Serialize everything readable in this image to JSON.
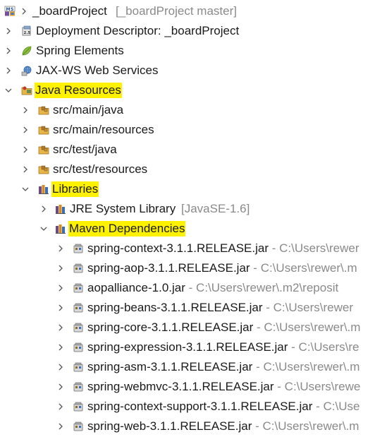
{
  "tree": {
    "project": {
      "name": "_boardProject",
      "decoration": "[_boardProject master]",
      "icon": "maven-web-project-icon"
    },
    "items": [
      {
        "label": "Deployment Descriptor: _boardProject",
        "icon": "deployment-descriptor-icon"
      },
      {
        "label": "Spring Elements",
        "icon": "spring-leaf-icon"
      },
      {
        "label": "JAX-WS Web Services",
        "icon": "web-services-icon"
      },
      {
        "label": "Java Resources",
        "icon": "java-resources-icon"
      },
      {
        "label": "src/main/java",
        "icon": "package-folder-icon"
      },
      {
        "label": "src/main/resources",
        "icon": "package-folder-icon"
      },
      {
        "label": "src/test/java",
        "icon": "package-folder-icon"
      },
      {
        "label": "src/test/resources",
        "icon": "package-folder-icon"
      },
      {
        "label": "Libraries",
        "icon": "libraries-icon"
      },
      {
        "label": "JRE System Library",
        "decoration": "[JavaSE-1.6]",
        "icon": "library-icon"
      },
      {
        "label": "Maven Dependencies",
        "icon": "library-icon"
      }
    ],
    "jars": [
      {
        "name": "spring-context-3.1.1.RELEASE.jar",
        "path": "C:\\Users\\rewer"
      },
      {
        "name": "spring-aop-3.1.1.RELEASE.jar",
        "path": "C:\\Users\\rewer\\.m"
      },
      {
        "name": "aopalliance-1.0.jar",
        "path": "C:\\Users\\rewer\\.m2\\reposit"
      },
      {
        "name": "spring-beans-3.1.1.RELEASE.jar",
        "path": "C:\\Users\\rewer"
      },
      {
        "name": "spring-core-3.1.1.RELEASE.jar",
        "path": "C:\\Users\\rewer\\.m"
      },
      {
        "name": "spring-expression-3.1.1.RELEASE.jar",
        "path": "C:\\Users\\re"
      },
      {
        "name": "spring-asm-3.1.1.RELEASE.jar",
        "path": "C:\\Users\\rewer\\.m"
      },
      {
        "name": "spring-webmvc-3.1.1.RELEASE.jar",
        "path": "C:\\Users\\rewe"
      },
      {
        "name": "spring-context-support-3.1.1.RELEASE.jar",
        "path": "C:\\Use"
      },
      {
        "name": "spring-web-3.1.1.RELEASE.jar",
        "path": "C:\\Users\\rewer\\.m"
      }
    ],
    "jar_separator": "-",
    "highlight_color": "#fff200"
  }
}
